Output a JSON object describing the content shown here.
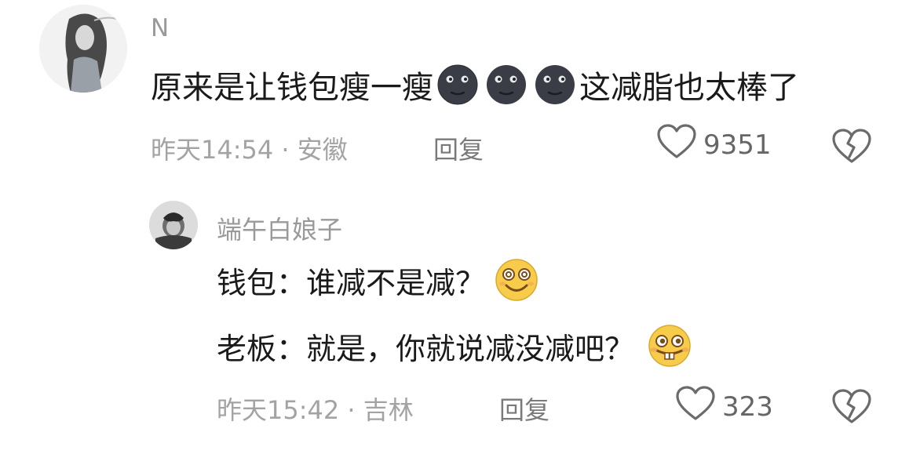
{
  "comments": [
    {
      "username": "N",
      "text_before_emoji": "原来是让钱包瘦一瘦",
      "emoji": [
        "new-moon-face-icon",
        "new-moon-face-icon",
        "new-moon-face-icon"
      ],
      "text_after_emoji": "这减脂也太棒了",
      "meta": "昨天14:54 · 安徽",
      "reply_label": "回复",
      "likes": "9351",
      "replies": [
        {
          "username": "端午白娘子",
          "lines": [
            {
              "text": "钱包：谁减不是减？",
              "emoji": "grin-squint-icon"
            },
            {
              "text": "老板：就是，你就说减没减吧？",
              "emoji": "buck-tooth-smile-icon"
            }
          ],
          "meta": "昨天15:42 · 吉林",
          "reply_label": "回复",
          "likes": "323"
        }
      ]
    }
  ],
  "colors": {
    "text": "#1a1a1a",
    "username": "#9a9a9a",
    "meta": "#a3a3a3",
    "icon": "#666666"
  }
}
